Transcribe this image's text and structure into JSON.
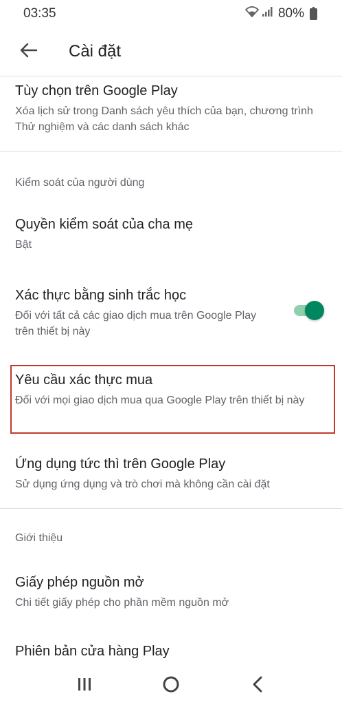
{
  "status_bar": {
    "time": "03:35",
    "battery": "80%",
    "icons": [
      "wifi-icon",
      "signal-icon",
      "battery-icon"
    ]
  },
  "app_bar": {
    "title": "Cài đặt",
    "back_icon": "arrow-back-icon"
  },
  "items": {
    "play_options": {
      "title": "Tùy chọn trên Google Play",
      "subtitle": "Xóa lịch sử trong Danh sách yêu thích của bạn, chương trình Thử nghiệm và các danh sách khác"
    },
    "parental": {
      "title": "Quyền kiểm soát của cha mẹ",
      "subtitle": "Bật"
    },
    "biometric": {
      "title": "Xác thực bằng sinh trắc học",
      "subtitle": "Đối với tất cả các giao dịch mua trên Google Play trên thiết bị này",
      "enabled": true
    },
    "purchase_auth": {
      "title": "Yêu cầu xác thực mua",
      "subtitle": "Đối với mọi giao dịch mua qua Google Play trên thiết bị này"
    },
    "instant_apps": {
      "title": "Ứng dụng tức thì trên Google Play",
      "subtitle": "Sử dụng ứng dụng và trò chơi mà không cần cài đặt"
    },
    "open_source": {
      "title": "Giấy phép nguồn mở",
      "subtitle": "Chi tiết giấy phép cho phần mềm nguồn mở"
    },
    "play_version": {
      "title": "Phiên bản cửa hàng Play"
    }
  },
  "sections": {
    "user_controls": "Kiểm soát của người dùng",
    "about": "Giới thiệu"
  },
  "colors": {
    "accent": "#01875f",
    "highlight": "#c0392b"
  },
  "nav_bar": {
    "icons": [
      "recents-icon",
      "home-icon",
      "back-icon"
    ]
  }
}
